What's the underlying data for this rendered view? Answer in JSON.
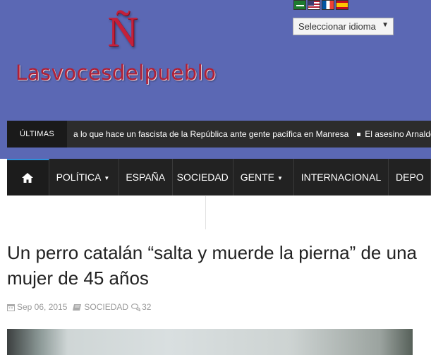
{
  "site": {
    "logo_mark": "Ñ",
    "logo_text": "Lasvocesdelpueblo"
  },
  "language": {
    "flags": [
      "flag-arabic",
      "flag-english",
      "flag-french",
      "flag-spanish"
    ],
    "select_label": "Seleccionar idioma"
  },
  "ticker": {
    "label": "ÚLTIMAS",
    "items": [
      "a lo que hace un fascista de la República ante gente pacífica en Manresa",
      "El asesino Arnaldo"
    ]
  },
  "nav": {
    "home_icon": "home-icon",
    "items": [
      "POLÍTICA",
      "ESPAÑA",
      "SOCIEDAD",
      "GENTE",
      "INTERNACIONAL",
      "DEPO"
    ]
  },
  "article": {
    "title": "Un perro catalán “salta y muerde la pierna” de una mujer de 45 años",
    "date": "Sep 06, 2015",
    "category": "SOCIEDAD",
    "comments": "32"
  },
  "colors": {
    "header_bg": "#5b68b4",
    "logo": "#b02036",
    "nav_bg": "#222222",
    "nav_accent": "#2f8fd8"
  }
}
